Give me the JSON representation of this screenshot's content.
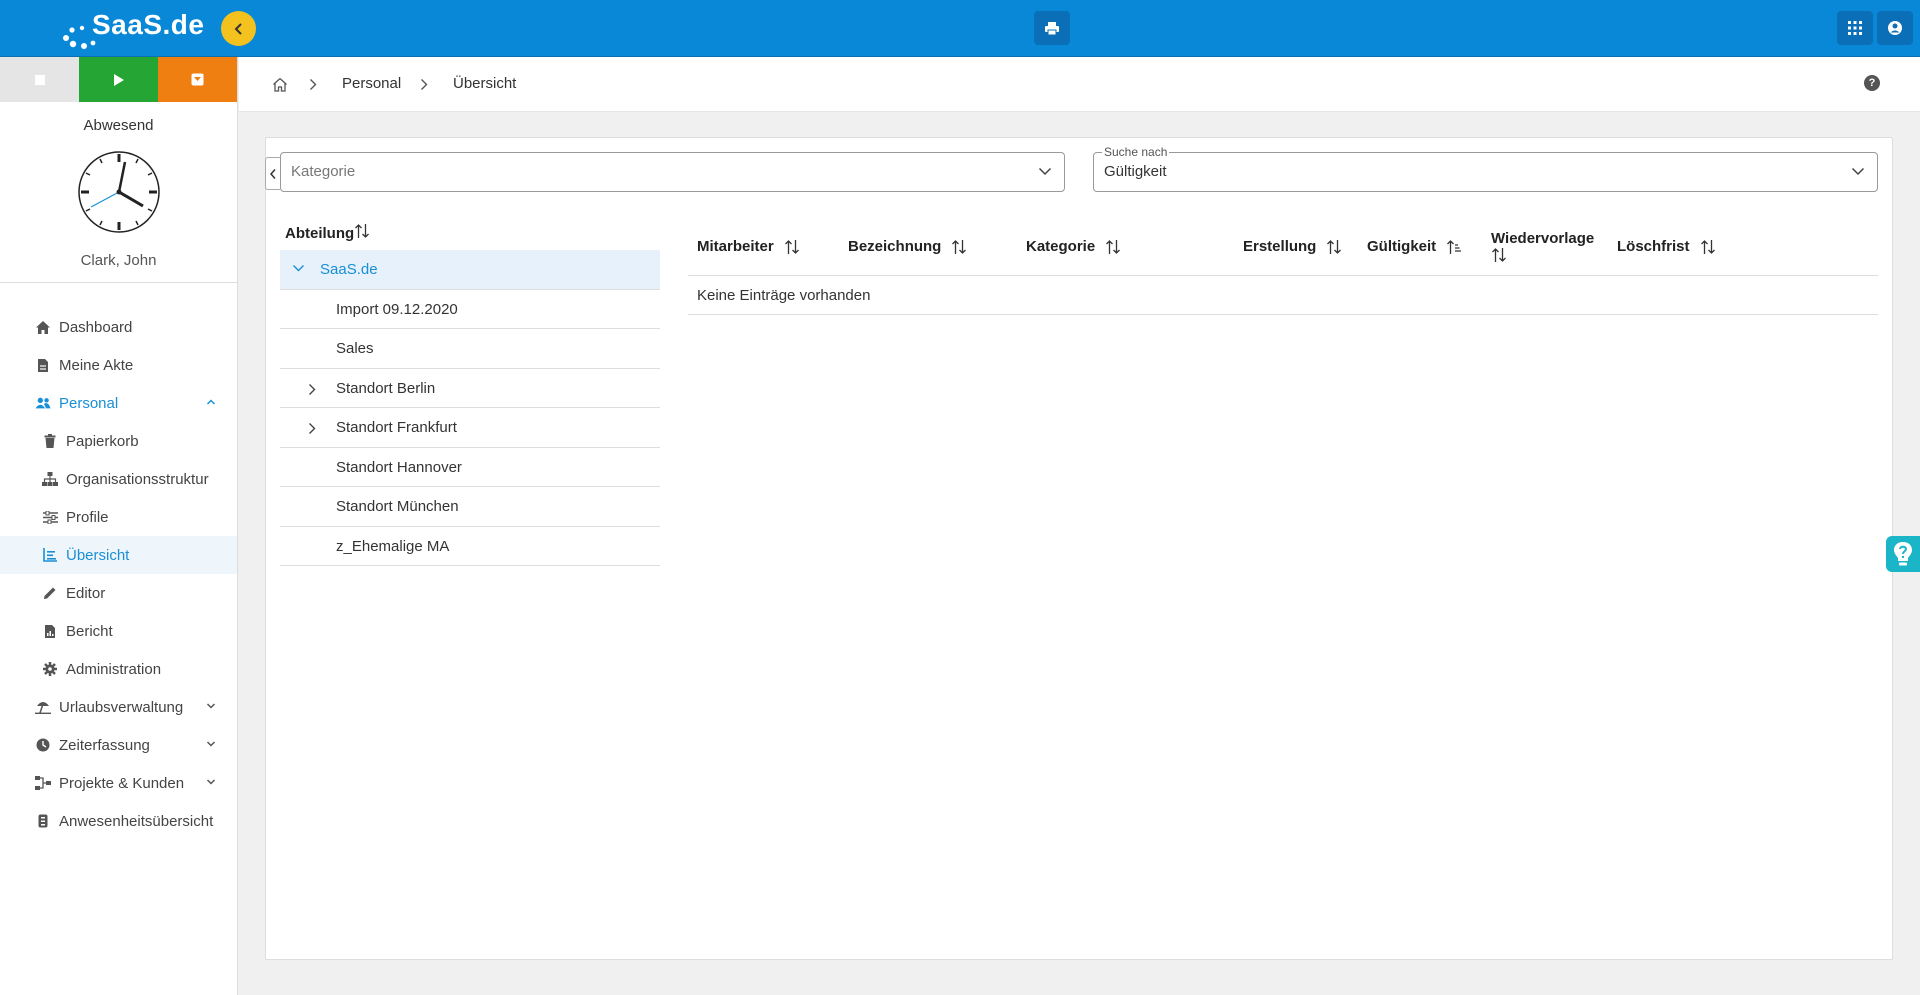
{
  "app": {
    "logo_text": "SaaS.de",
    "colors": {
      "header": "#0a88d8",
      "accent": "#1a8fd6",
      "start": "#24a534",
      "pause": "#f07f12",
      "collapse": "#f4c21f"
    }
  },
  "header": {
    "icons": [
      "chevron-left-icon",
      "print-icon",
      "apps-grid-icon",
      "user-circle-icon"
    ]
  },
  "sidebar": {
    "status": "Abwesend",
    "user_name": "Clark, John",
    "nav": [
      {
        "label": "Dashboard",
        "icon": "home-icon"
      },
      {
        "label": "Meine Akte",
        "icon": "file-icon"
      },
      {
        "label": "Personal",
        "icon": "users-icon",
        "expanded": true
      },
      {
        "label": "Papierkorb",
        "icon": "trash-icon"
      },
      {
        "label": "Organisationsstruktur",
        "icon": "sitemap-icon"
      },
      {
        "label": "Profile",
        "icon": "sliders-icon"
      },
      {
        "label": "Übersicht",
        "icon": "list-chart-icon",
        "selected": true
      },
      {
        "label": "Editor",
        "icon": "pencil-icon"
      },
      {
        "label": "Bericht",
        "icon": "report-icon"
      },
      {
        "label": "Administration",
        "icon": "gear-icon"
      },
      {
        "label": "Urlaubsverwaltung",
        "icon": "beach-umbrella-icon"
      },
      {
        "label": "Zeiterfassung",
        "icon": "clock-icon"
      },
      {
        "label": "Projekte & Kunden",
        "icon": "project-tree-icon"
      },
      {
        "label": "Anwesenheitsübersicht",
        "icon": "badge-icon"
      }
    ]
  },
  "breadcrumb": [
    "Personal",
    "Übersicht"
  ],
  "filters": {
    "kategorie_placeholder": "Kategorie",
    "suche_label": "Suche nach",
    "suche_value": "Gültigkeit"
  },
  "departments": {
    "header": "Abteilung",
    "root": "SaaS.de",
    "items": [
      "Import 09.12.2020",
      "Sales",
      "Standort Berlin",
      "Standort Frankfurt",
      "Standort Hannover",
      "Standort München",
      "z_Ehemalige MA"
    ]
  },
  "table": {
    "columns": [
      "Mitarbeiter",
      "Bezeichnung",
      "Kategorie",
      "Erstellung",
      "Gültigkeit",
      "Wiedervorlage",
      "Löschfrist"
    ],
    "sorted_column": "Gültigkeit",
    "empty_text": "Keine Einträge vorhanden"
  }
}
